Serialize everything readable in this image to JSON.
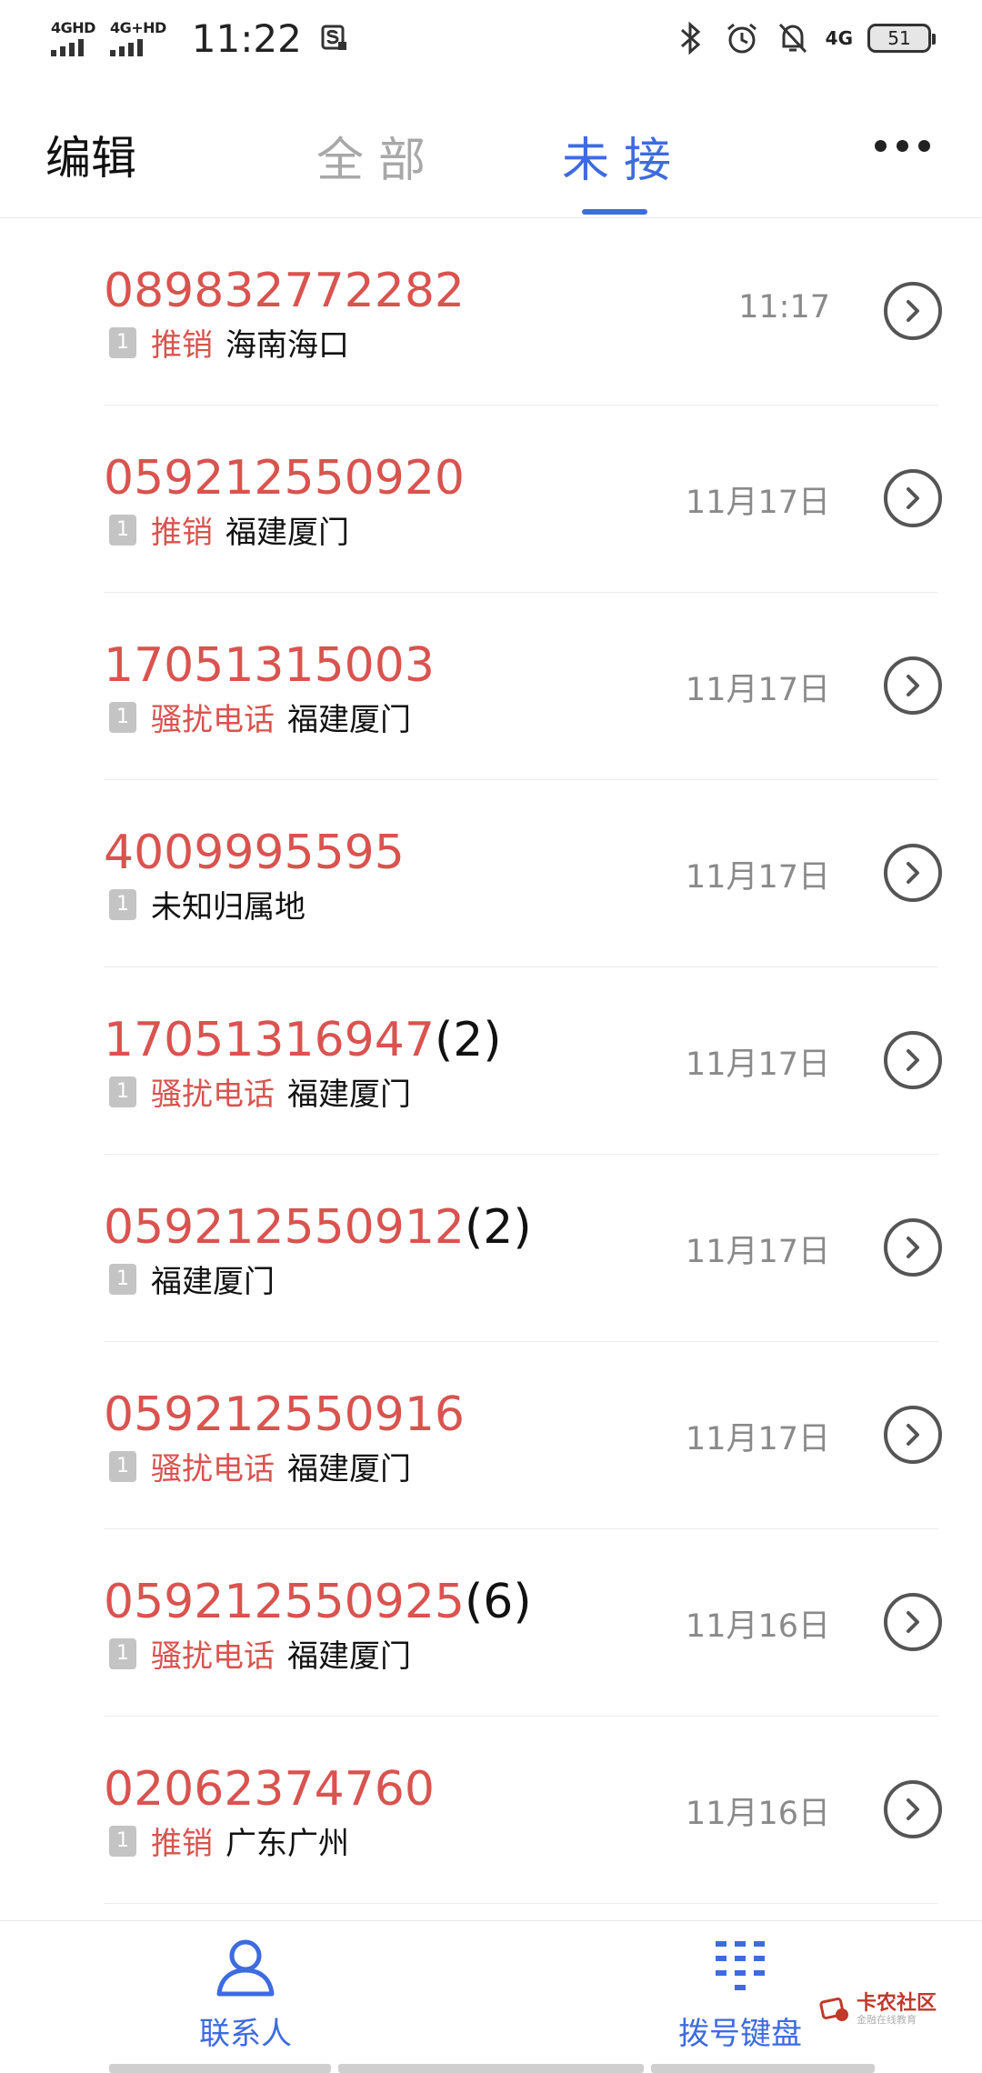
{
  "status_bar": {
    "network1": "4GHD",
    "network2": "4G+HD",
    "time": "11:22",
    "network3": "4G",
    "battery": "51"
  },
  "tabs": {
    "edit": "编辑",
    "all": "全部",
    "missed": "未接"
  },
  "calls": [
    {
      "number": "089832772282",
      "count": "",
      "tag": "推销",
      "location": "海南海口",
      "date": "11:17"
    },
    {
      "number": "059212550920",
      "count": "",
      "tag": "推销",
      "location": "福建厦门",
      "date": "11月17日"
    },
    {
      "number": "17051315003",
      "count": "",
      "tag": "骚扰电话",
      "location": "福建厦门",
      "date": "11月17日"
    },
    {
      "number": "4009995595",
      "count": "",
      "tag": "",
      "location": "未知归属地",
      "date": "11月17日"
    },
    {
      "number": "17051316947",
      "count": "(2)",
      "tag": "骚扰电话",
      "location": "福建厦门",
      "date": "11月17日"
    },
    {
      "number": "059212550912",
      "count": "(2)",
      "tag": "",
      "location": "福建厦门",
      "date": "11月17日"
    },
    {
      "number": "059212550916",
      "count": "",
      "tag": "骚扰电话",
      "location": "福建厦门",
      "date": "11月17日"
    },
    {
      "number": "059212550925",
      "count": "(6)",
      "tag": "骚扰电话",
      "location": "福建厦门",
      "date": "11月16日"
    },
    {
      "number": "02062374760",
      "count": "",
      "tag": "推销",
      "location": "广东广州",
      "date": "11月16日"
    }
  ],
  "sim_label": "1",
  "bottom_nav": {
    "contacts": "联系人",
    "dialpad": "拨号键盘"
  },
  "watermark": {
    "main": "卡农社区",
    "sub": "金融在线教育"
  },
  "colors": {
    "accent": "#3d6be0",
    "number_red": "#d9534f",
    "date_gray": "#8a8a8a"
  }
}
